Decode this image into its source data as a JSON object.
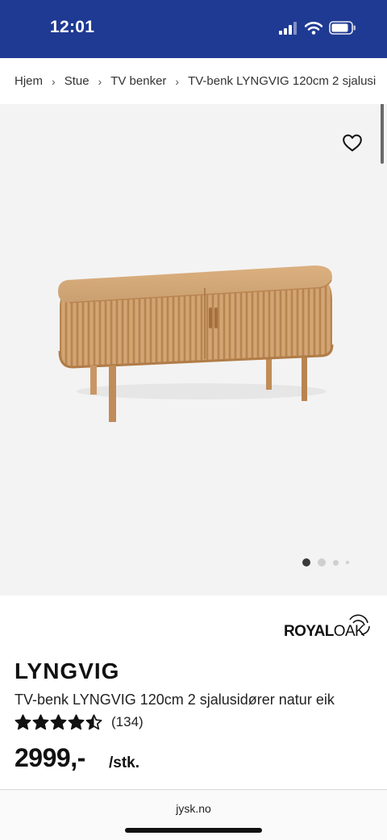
{
  "status_bar": {
    "time": "12:01",
    "background": "#1f3a93",
    "icons": [
      "signal-icon",
      "wifi-icon",
      "battery-icon"
    ]
  },
  "breadcrumb": {
    "items": [
      "Hjem",
      "Stue",
      "TV benker",
      "TV-benk LYNGVIG 120cm 2 sjalusi"
    ],
    "separator": "›"
  },
  "gallery": {
    "favorite_icon": "heart-outline-icon",
    "image_count": 4,
    "active_index": 0
  },
  "product": {
    "brand": "ROYALOAK",
    "name": "LYNGVIG",
    "description": "TV-benk LYNGVIG 120cm 2 sjalusidører natur eik",
    "rating_value": 4.5,
    "rating_count": "(134)",
    "price": "2999,-",
    "unit": "/stk."
  },
  "browser": {
    "url": "jysk.no"
  }
}
